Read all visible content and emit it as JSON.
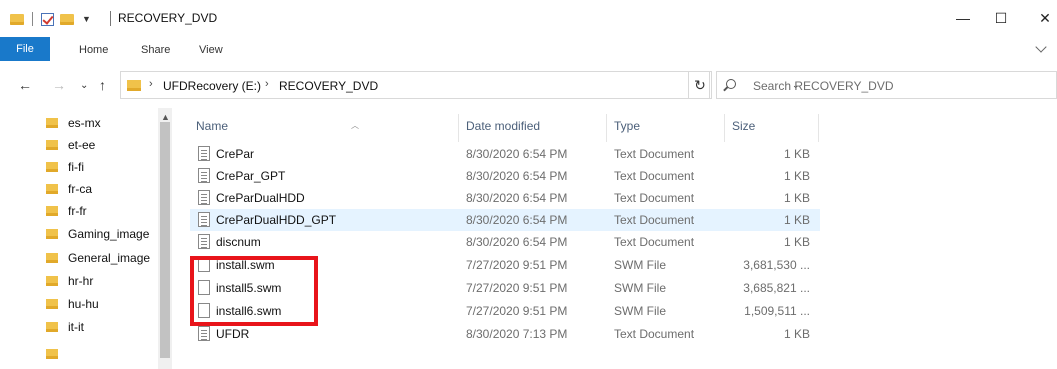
{
  "window": {
    "title": "RECOVERY_DVD",
    "minimize_glyph": "—",
    "maximize_glyph": "☐",
    "close_glyph": "✕"
  },
  "ribbon": {
    "tabs": [
      "File",
      "Home",
      "Share",
      "View"
    ]
  },
  "address": {
    "crumbs": [
      "UFDRecovery (E:)",
      "RECOVERY_DVD"
    ],
    "separator": "›"
  },
  "search": {
    "placeholder": "Search RECOVERY_DVD"
  },
  "nav_pane": {
    "items": [
      "es-mx",
      "et-ee",
      "fi-fi",
      "fr-ca",
      "fr-fr",
      "Gaming_image",
      "General_image",
      "hr-hr",
      "hu-hu",
      "it-it"
    ]
  },
  "file_list": {
    "columns": [
      "Name",
      "Date modified",
      "Type",
      "Size"
    ],
    "rows": [
      {
        "name": "CrePar",
        "date": "8/30/2020 6:54 PM",
        "type": "Text Document",
        "size": "1 KB",
        "icon": "text-document-icon"
      },
      {
        "name": "CrePar_GPT",
        "date": "8/30/2020 6:54 PM",
        "type": "Text Document",
        "size": "1 KB",
        "icon": "text-document-icon"
      },
      {
        "name": "CreParDualHDD",
        "date": "8/30/2020 6:54 PM",
        "type": "Text Document",
        "size": "1 KB",
        "icon": "text-document-icon"
      },
      {
        "name": "CreParDualHDD_GPT",
        "date": "8/30/2020 6:54 PM",
        "type": "Text Document",
        "size": "1 KB",
        "icon": "text-document-icon"
      },
      {
        "name": "discnum",
        "date": "8/30/2020 6:54 PM",
        "type": "Text Document",
        "size": "1 KB",
        "icon": "text-document-icon"
      },
      {
        "name": "install.swm",
        "date": "7/27/2020 9:51 PM",
        "type": "SWM File",
        "size": "3,681,530 ...",
        "icon": "blank-file-icon"
      },
      {
        "name": "install5.swm",
        "date": "7/27/2020 9:51 PM",
        "type": "SWM File",
        "size": "3,685,821 ...",
        "icon": "blank-file-icon"
      },
      {
        "name": "install6.swm",
        "date": "7/27/2020 9:51 PM",
        "type": "SWM File",
        "size": "1,509,511 ...",
        "icon": "blank-file-icon"
      },
      {
        "name": "UFDR",
        "date": "8/30/2020 7:13 PM",
        "type": "Text Document",
        "size": "1 KB",
        "icon": "text-document-icon"
      }
    ],
    "hovered_row": "CreParDualHDD_GPT"
  },
  "colors": {
    "file_tab": "#1979ca",
    "hover_row": "#e5f3ff",
    "highlight_box": "#e8141a",
    "folder": "#f0c24a"
  }
}
